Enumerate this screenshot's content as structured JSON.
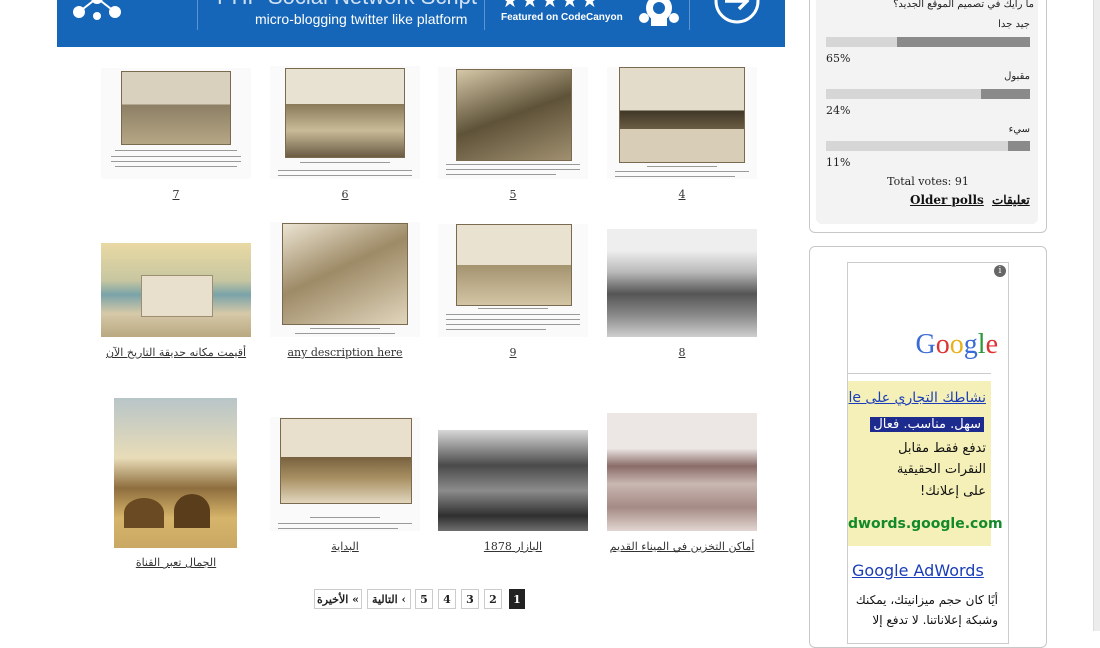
{
  "banner": {
    "title": "PHP Social Network Script",
    "subtitle": "micro-blogging twitter like platform",
    "featured": "Featured on CodeCanyon",
    "stars": "★★★★★",
    "colors": {
      "background": "#1565b8",
      "text": "#ffffff"
    }
  },
  "gallery": {
    "items": [
      {
        "caption": "7"
      },
      {
        "caption": "6"
      },
      {
        "caption": "5"
      },
      {
        "caption": "4"
      },
      {
        "caption": "أقيمت مكانه حديقة التاريخ الآن"
      },
      {
        "caption": "any description here"
      },
      {
        "caption": "9"
      },
      {
        "caption": "8"
      },
      {
        "caption": "الجمال تعبر القناة"
      },
      {
        "caption": "البداية"
      },
      {
        "caption": "البازار 1878"
      },
      {
        "caption": "أماكن التخزين في الميناء القديم"
      }
    ]
  },
  "pager": {
    "last": "الأخيرة «",
    "next": "التالية ‹",
    "pages": [
      "5",
      "4",
      "3",
      "2",
      "1"
    ],
    "active": "1"
  },
  "poll": {
    "question": "ما رأيك في تصميم الموقع الجديد؟",
    "options": [
      {
        "label": "جيد جدا",
        "percent_text": "65%",
        "percent": 65
      },
      {
        "label": "مقبول",
        "percent_text": "24%",
        "percent": 24
      },
      {
        "label": "سيء",
        "percent_text": "11%",
        "percent": 11
      }
    ],
    "total": "Total votes: 91",
    "comments_link": "تعليقات",
    "older_link": "Older polls"
  },
  "ad": {
    "brand": "Google",
    "headline": "نشاطك التجاري على le",
    "highlight": "سهل. مناسب. فعال",
    "lines": [
      "تدفع فقط مقابل",
      "النقرات الحقيقية",
      "على إعلانك!"
    ],
    "url": "dwords.google.com",
    "product": "Google AdWords",
    "body": [
      "أيًا كان حجم ميزانيتك، يمكنك",
      "وشبكة إعلاناتنا. لا تدفع إلا"
    ],
    "info_icon": "info-icon"
  }
}
